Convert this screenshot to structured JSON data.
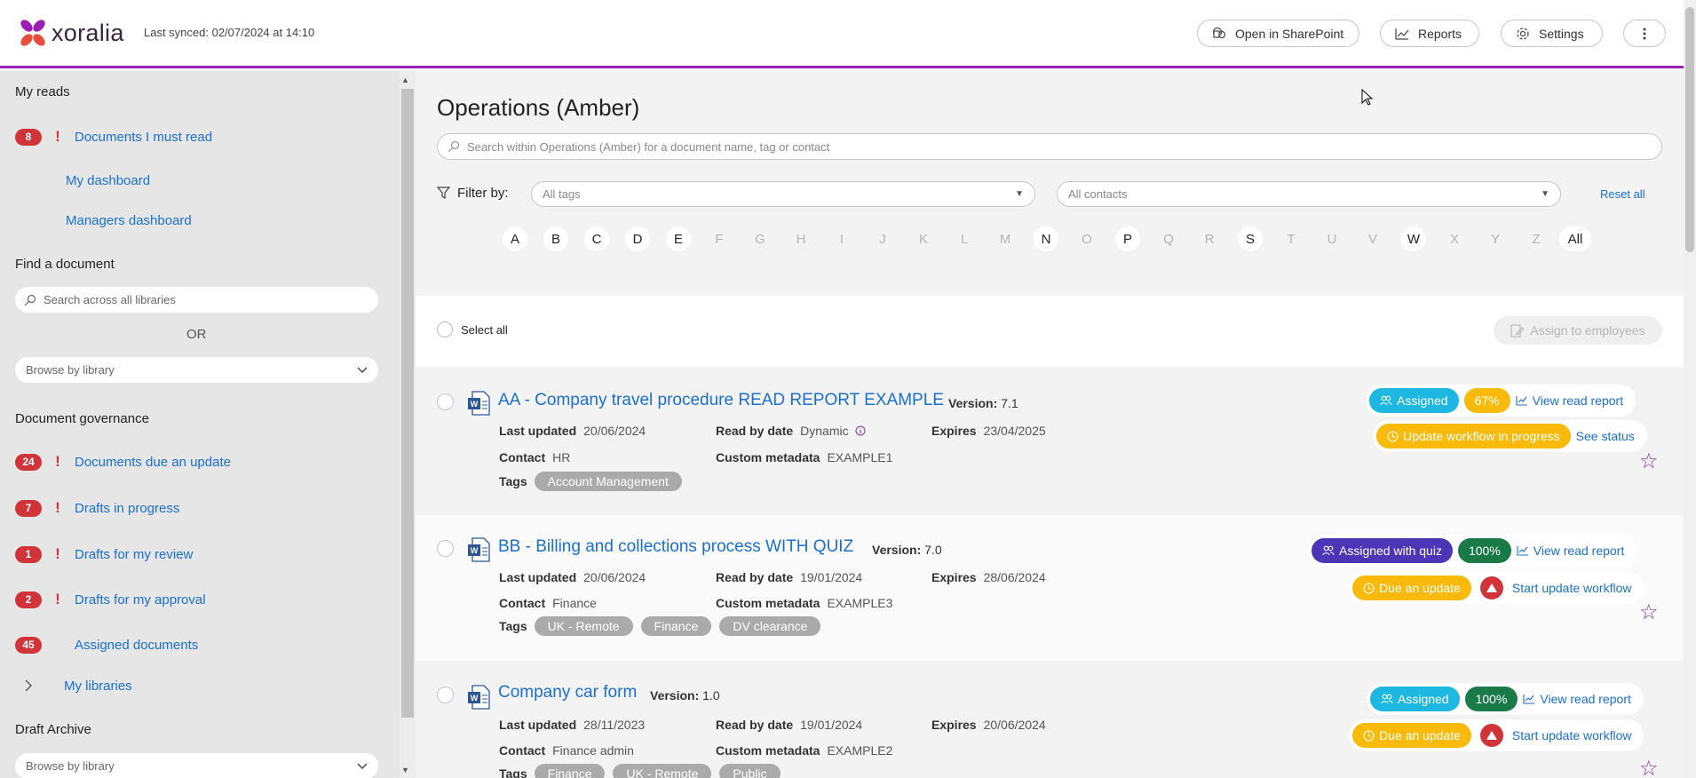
{
  "header": {
    "logo_text": "xoralia",
    "last_synced": "Last synced: 02/07/2024 at 14:10",
    "buttons": {
      "sharepoint": "Open in SharePoint",
      "reports": "Reports",
      "settings": "Settings"
    },
    "accent_color": "#9b1fb5"
  },
  "sidebar": {
    "my_reads_heading": "My reads",
    "must_read": {
      "count": "8",
      "label": "Documents I must read"
    },
    "my_dashboard": "My dashboard",
    "managers_dashboard": "Managers dashboard",
    "find_heading": "Find a document",
    "search_placeholder": "Search across all libraries",
    "or_text": "OR",
    "browse_placeholder": "Browse by library",
    "governance_heading": "Document governance",
    "governance_items": [
      {
        "count": "24",
        "label": "Documents due an update"
      },
      {
        "count": "7",
        "label": "Drafts in progress"
      },
      {
        "count": "1",
        "label": "Drafts for my review"
      },
      {
        "count": "2",
        "label": "Drafts for my approval"
      }
    ],
    "assigned": {
      "count": "45",
      "label": "Assigned documents"
    },
    "my_libraries": "My libraries",
    "draft_archive_heading": "Draft Archive",
    "draft_browse_placeholder": "Browse by library"
  },
  "main": {
    "title": "Operations (Amber)",
    "search_placeholder": "Search within Operations (Amber) for a document name, tag or contact",
    "filter_label": "Filter by:",
    "tags_placeholder": "All tags",
    "contacts_placeholder": "All contacts",
    "reset_all": "Reset all",
    "letters": [
      {
        "l": "A",
        "on": true
      },
      {
        "l": "B",
        "on": true
      },
      {
        "l": "C",
        "on": true
      },
      {
        "l": "D",
        "on": true
      },
      {
        "l": "E",
        "on": true
      },
      {
        "l": "F",
        "on": false
      },
      {
        "l": "G",
        "on": false
      },
      {
        "l": "H",
        "on": false
      },
      {
        "l": "I",
        "on": false
      },
      {
        "l": "J",
        "on": false
      },
      {
        "l": "K",
        "on": false
      },
      {
        "l": "L",
        "on": false
      },
      {
        "l": "M",
        "on": false
      },
      {
        "l": "N",
        "on": true
      },
      {
        "l": "O",
        "on": false
      },
      {
        "l": "P",
        "on": true
      },
      {
        "l": "Q",
        "on": false
      },
      {
        "l": "R",
        "on": false
      },
      {
        "l": "S",
        "on": true
      },
      {
        "l": "T",
        "on": false
      },
      {
        "l": "U",
        "on": false
      },
      {
        "l": "V",
        "on": false
      },
      {
        "l": "W",
        "on": true
      },
      {
        "l": "X",
        "on": false
      },
      {
        "l": "Y",
        "on": false
      },
      {
        "l": "Z",
        "on": false
      }
    ],
    "all_letter": "All",
    "select_all": "Select all",
    "assign_button": "Assign to employees",
    "labels": {
      "version": "Version:",
      "last_updated": "Last updated",
      "read_by": "Read by date",
      "expires": "Expires",
      "contact": "Contact",
      "custom": "Custom metadata",
      "tags": "Tags",
      "view_report": "View read report"
    },
    "documents": [
      {
        "title": "AA - Company travel procedure READ REPORT EXAMPLE",
        "version": "7.1",
        "last_updated": "20/06/2024",
        "read_by": "Dynamic",
        "expires": "23/04/2025",
        "contact": "HR",
        "custom": "EXAMPLE1",
        "tags": [
          "Account Management"
        ],
        "assigned": "Assigned",
        "percent": "67%",
        "status": "Update workflow in progress",
        "status_action": "See status"
      },
      {
        "title": "BB - Billing and collections process WITH QUIZ",
        "version": "7.0",
        "last_updated": "20/06/2024",
        "read_by": "19/01/2024",
        "expires": "28/06/2024",
        "contact": "Finance",
        "custom": "EXAMPLE3",
        "tags": [
          "UK - Remote",
          "Finance",
          "DV clearance"
        ],
        "assigned": "Assigned with quiz",
        "percent": "100%",
        "status": "Due an update",
        "status_action": "Start update workflow"
      },
      {
        "title": "Company car form",
        "version": "1.0",
        "last_updated": "28/11/2023",
        "read_by": "19/01/2024",
        "expires": "20/06/2024",
        "contact": "Finance admin",
        "custom": "EXAMPLE2",
        "tags": [
          "Finance",
          "UK - Remote",
          "Public"
        ],
        "assigned": "Assigned",
        "percent": "100%",
        "status": "Due an update",
        "status_action": "Start update workflow"
      }
    ]
  }
}
